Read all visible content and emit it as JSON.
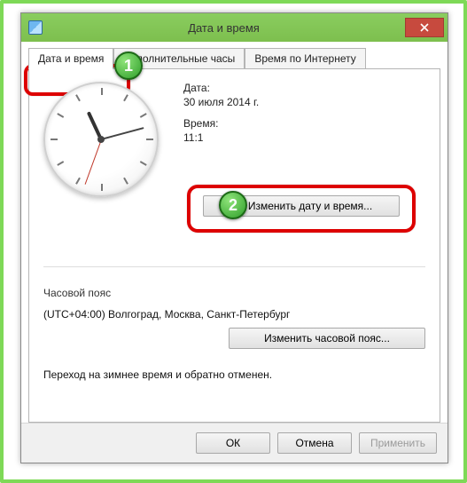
{
  "window": {
    "title": "Дата и время"
  },
  "tabs": {
    "tab1": "Дата и время",
    "tab2": "Дополнительные часы",
    "tab3": "Время по Интернету"
  },
  "datetime": {
    "date_label": "Дата:",
    "date_value": "30 июля 2014 г.",
    "time_label": "Время:",
    "time_value": "11:1",
    "change_button": "Изменить дату и время..."
  },
  "timezone": {
    "heading": "Часовой пояс",
    "value": "(UTC+04:00) Волгоград, Москва, Санкт-Петербург",
    "change_button": "Изменить часовой пояс..."
  },
  "dst_notice": "Переход на зимнее время и обратно отменен.",
  "dialog": {
    "ok": "ОК",
    "cancel": "Отмена",
    "apply": "Применить"
  },
  "annotations": {
    "badge1": "1",
    "badge2": "2"
  }
}
